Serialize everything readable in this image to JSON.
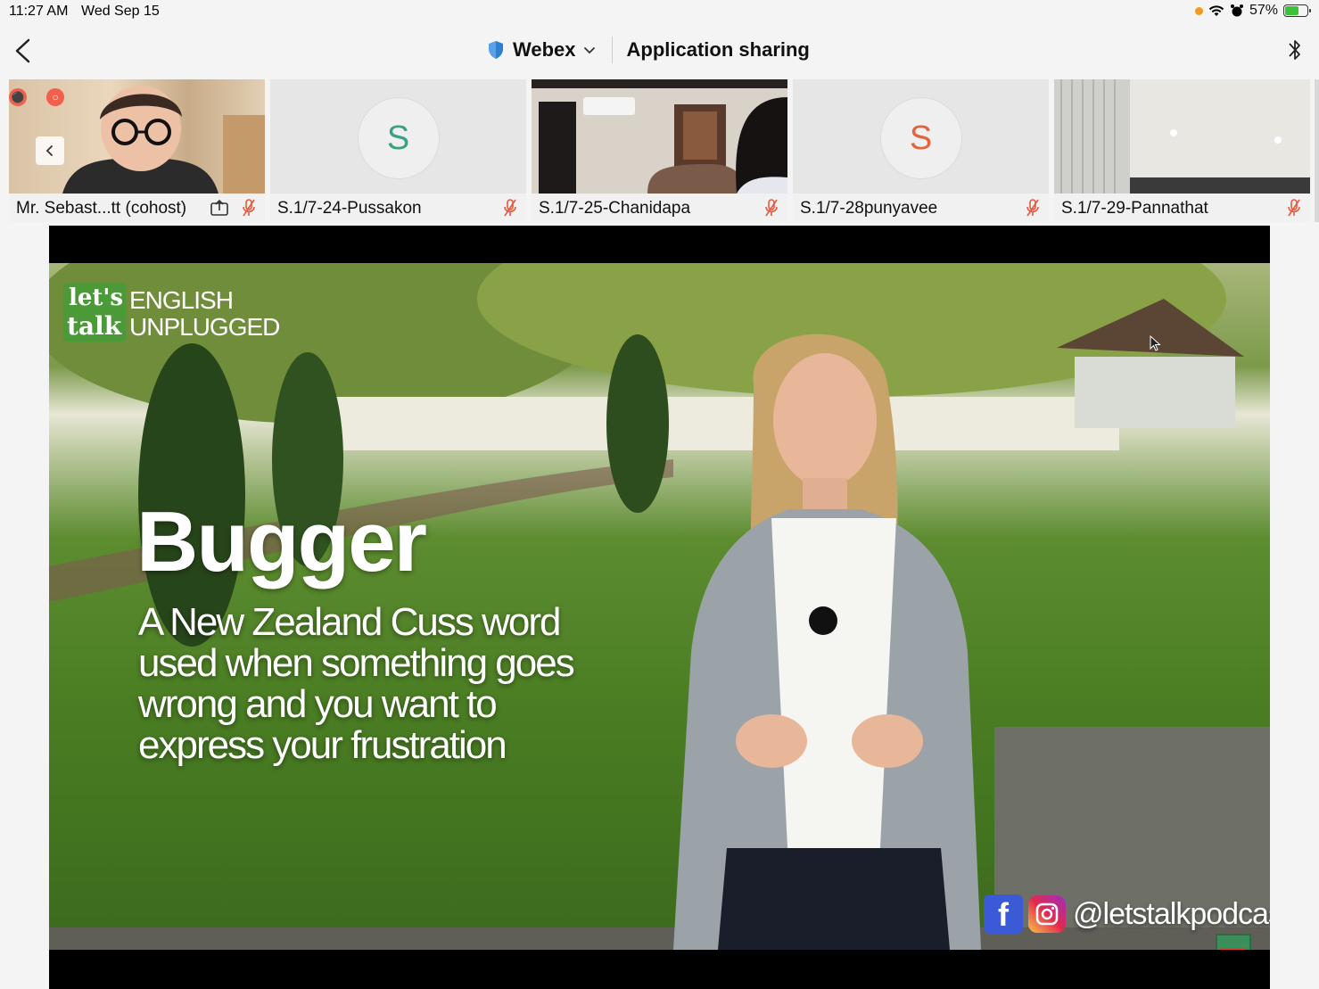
{
  "status_bar": {
    "time": "11:27 AM",
    "date": "Wed Sep 15",
    "battery": "57%",
    "battery_level": 0.57
  },
  "nav": {
    "brand": "Webex",
    "title": "Application sharing"
  },
  "participants": [
    {
      "name": "Mr. Sebast...tt (cohost)",
      "avatar_letter": "",
      "muted": true,
      "sharing": true,
      "has_video": true
    },
    {
      "name": "S.1/7-24-Pussakon",
      "avatar_letter": "S",
      "avatar_color": "#3aa184",
      "muted": true,
      "has_video": false
    },
    {
      "name": "S.1/7-25-Chanidapa",
      "avatar_letter": "",
      "muted": true,
      "has_video": true
    },
    {
      "name": "S.1/7-28punyavee",
      "avatar_letter": "S",
      "avatar_color": "#e2643b",
      "muted": true,
      "has_video": false
    },
    {
      "name": "S.1/7-29-Pannathat",
      "avatar_letter": "",
      "muted": true,
      "has_video": true
    }
  ],
  "shared_content": {
    "logo": {
      "line1": "let's",
      "line2": "talk",
      "line3": "ENGLISH",
      "line4": "UNPLUGGED"
    },
    "headline": "Bugger",
    "description_lines": [
      "A New Zealand Cuss word",
      "used when something goes",
      "wrong and you want to",
      "express your frustration"
    ],
    "social_handle": "@letstalkpodcast",
    "fb_letter": "f"
  },
  "colors": {
    "accent": "#1f77d4",
    "mic_muted": "#e5583f",
    "record": "#f0604c"
  }
}
